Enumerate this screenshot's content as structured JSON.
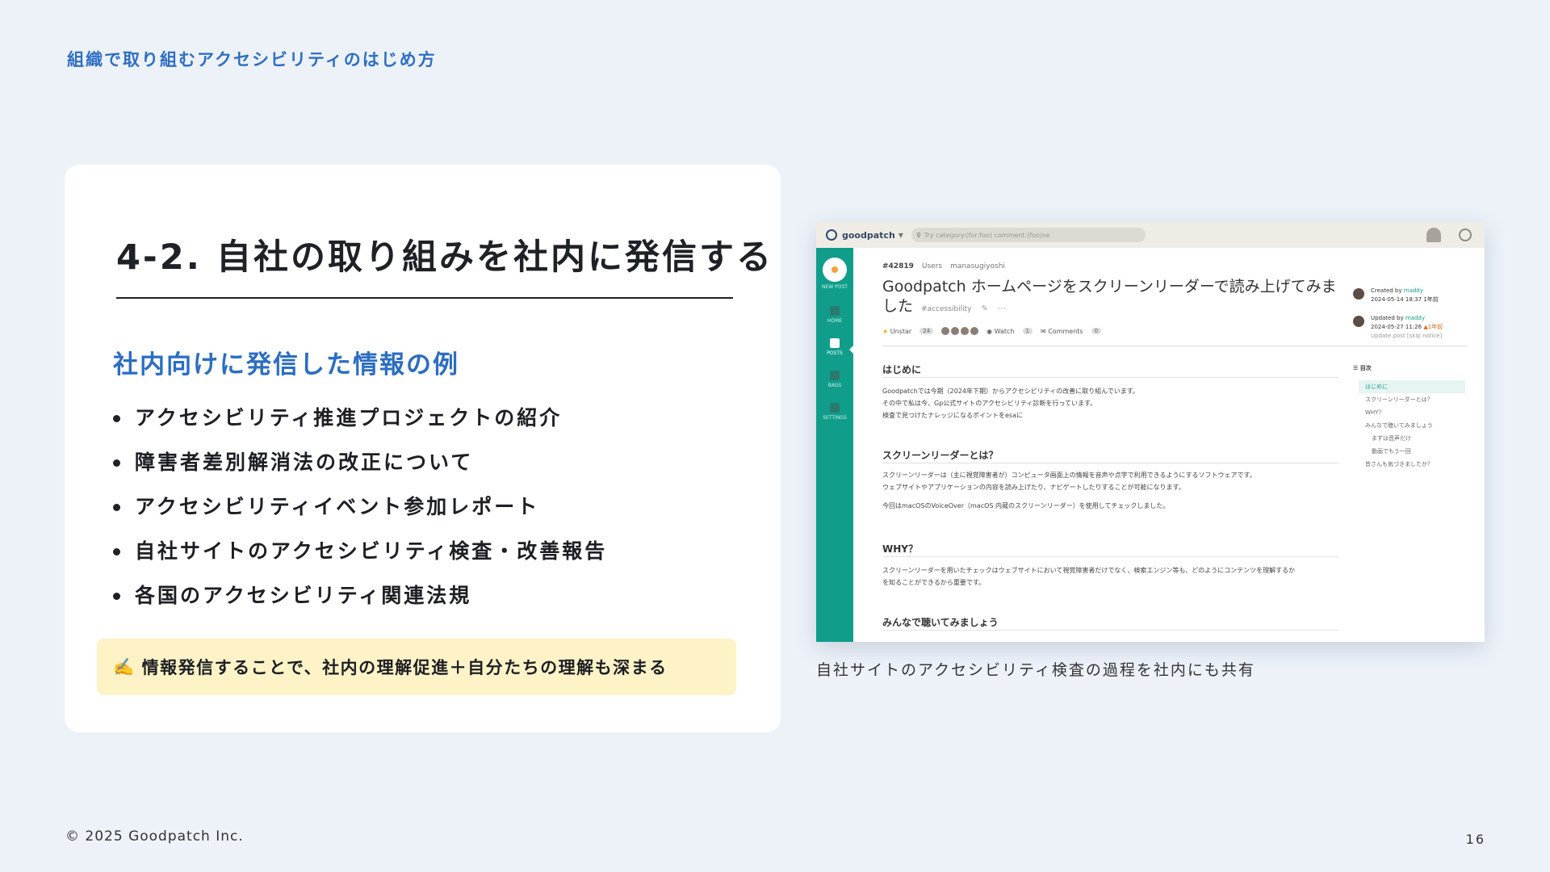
{
  "header": {
    "section_title": "組織で取り組むアクセシビリティのはじめ方"
  },
  "card": {
    "title": "4-2. 自社の取り組みを社内に発信する",
    "heading": "社内向けに発信した情報の例",
    "bullets": [
      "アクセシビリティ推進プロジェクトの紹介",
      "障害者差別解消法の改正について",
      "アクセシビリティイベント参加レポート",
      "自社サイトのアクセシビリティ検査・改善報告",
      "各国のアクセシビリティ関連法規"
    ],
    "note": {
      "emoji": "✍️",
      "text": "情報発信することで、社内の理解促進＋自分たちの理解も深まる"
    }
  },
  "screenshot": {
    "brand": "goodpatch",
    "search_placeholder": "Try category:(for:foo) comment:(foo)se",
    "sidebar": {
      "new_post": "NEW POST",
      "items": [
        "HOME",
        "POSTS",
        "BAGS",
        "SETTINGS"
      ]
    },
    "post": {
      "number": "#42819",
      "category": "Users",
      "author": "manasugiyoshi",
      "title": "Goodpatch ホームページをスクリーンリーダーで読み上げてみました",
      "tag": "#accessibility",
      "unstar_label": "Unstar",
      "star_count": "24",
      "watch_label": "Watch",
      "watch_count": "1",
      "comments_label": "Comments",
      "comments_count": "0"
    },
    "info": {
      "created_label": "Created by",
      "created_user": "maddy",
      "created_date": "2024-05-14 18:37",
      "created_ago": "1年前",
      "updated_label": "Updated by",
      "updated_user": "maddy",
      "updated_date": "2024-05-27 11:26",
      "updated_ago": "1年前",
      "update_note": "Update post [skip notice]"
    },
    "sections": [
      {
        "heading": "はじめに",
        "lines": [
          "Goodpatchでは今期（2024年下期）からアクセシビリティの改善に取り組んでいます。",
          "その中で私は今、Gp公式サイトのアクセシビリティ診断を行っています。",
          "検査で見つけたナレッジになるポイントをesaに"
        ]
      },
      {
        "heading": "スクリーンリーダーとは？",
        "lines": [
          "スクリーンリーダーは（主に視覚障害者が）コンピュータ画面上の情報を音声や点字で利用できるようにするソフトウェアです。",
          "ウェブサイトやアプリケーションの内容を読み上げたり、ナビゲートしたりすることが可能になります。",
          "",
          "今回はmacOSのVoiceOver（macOS 内蔵のスクリーンリーダー）を使用してチェックしました。"
        ]
      },
      {
        "heading": "WHY？",
        "lines": [
          "スクリーンリーダーを用いたチェックはウェブサイトにおいて視覚障害者だけでなく、検索エンジン等も、どのようにコンテンツを理解するか",
          "を知ることができるから重要です。"
        ]
      },
      {
        "heading": "みんなで聴いてみましょう",
        "lines": []
      }
    ],
    "toc_title": "目次",
    "toc": [
      "はじめに",
      "スクリーンリーダーとは？",
      "WHY？",
      "みんなで聴いてみましょう",
      "まずは音声だけ",
      "動画でもう一回",
      "皆さんも気づきましたか？"
    ]
  },
  "caption": "自社サイトのアクセシビリティ検査の過程を社内にも共有",
  "footer": {
    "copyright": "© 2025 Goodpatch Inc.",
    "page_number": "16"
  }
}
